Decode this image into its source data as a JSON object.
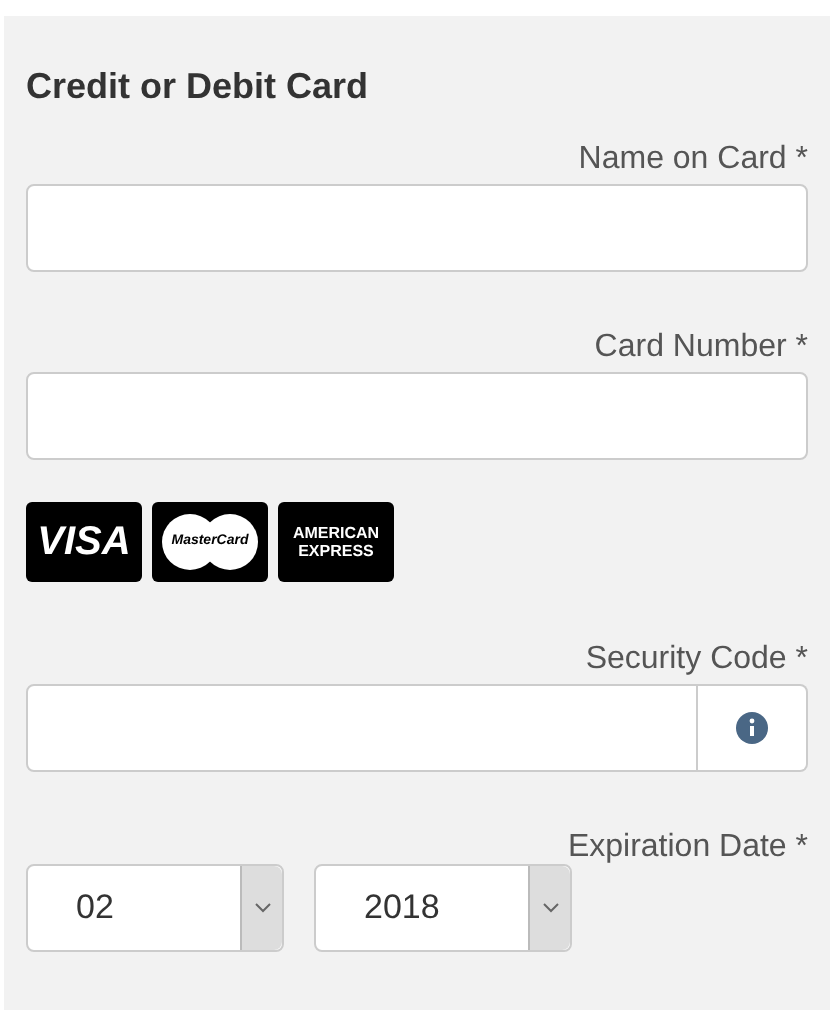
{
  "title": "Credit or Debit Card",
  "fields": [
    {
      "kind": "text",
      "label": "Name on Card *"
    },
    {
      "kind": "text",
      "label": "Card Number *"
    },
    {
      "kind": "cards",
      "cards": [
        {
          "kind": "visa",
          "label": "VISA"
        },
        {
          "kind": "mastercard",
          "label": "MasterCard"
        },
        {
          "kind": "amex",
          "label": "AMERICAN EXPRESS"
        }
      ]
    },
    {
      "kind": "info",
      "label": "Security Code *"
    },
    {
      "kind": "selects",
      "label": "Expiration Date *",
      "selects": [
        {
          "value": "02"
        },
        {
          "value": "2018"
        }
      ]
    }
  ]
}
